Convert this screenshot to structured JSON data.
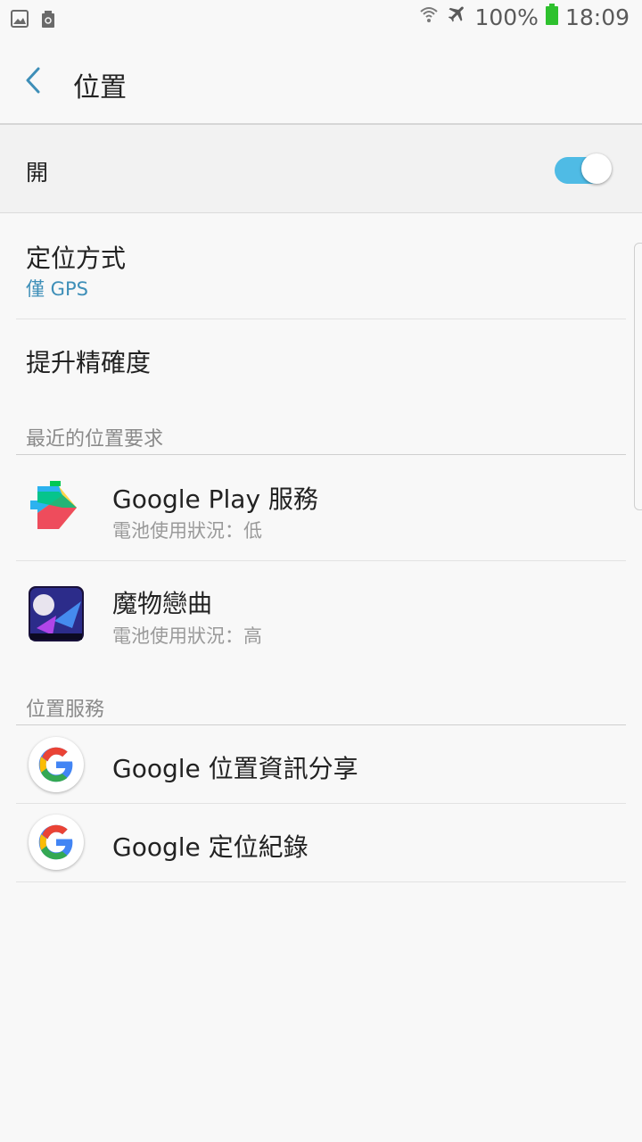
{
  "status": {
    "battery": "100%",
    "time": "18:09"
  },
  "header": {
    "title": "位置"
  },
  "master": {
    "label": "開",
    "enabled": true
  },
  "settings": {
    "mode_title": "定位方式",
    "mode_value": "僅 GPS",
    "accuracy_title": "提升精確度"
  },
  "recent": {
    "header": "最近的位置要求",
    "apps": [
      {
        "name": "Google Play 服務",
        "battery": "電池使用狀況：低"
      },
      {
        "name": "魔物戀曲",
        "battery": "電池使用狀況：高"
      }
    ]
  },
  "services": {
    "header": "位置服務",
    "items": [
      {
        "label": "Google 位置資訊分享"
      },
      {
        "label": "Google 定位紀錄"
      }
    ]
  },
  "colors": {
    "accent": "#3e8fb8",
    "toggle_on": "#4fbbe5"
  }
}
